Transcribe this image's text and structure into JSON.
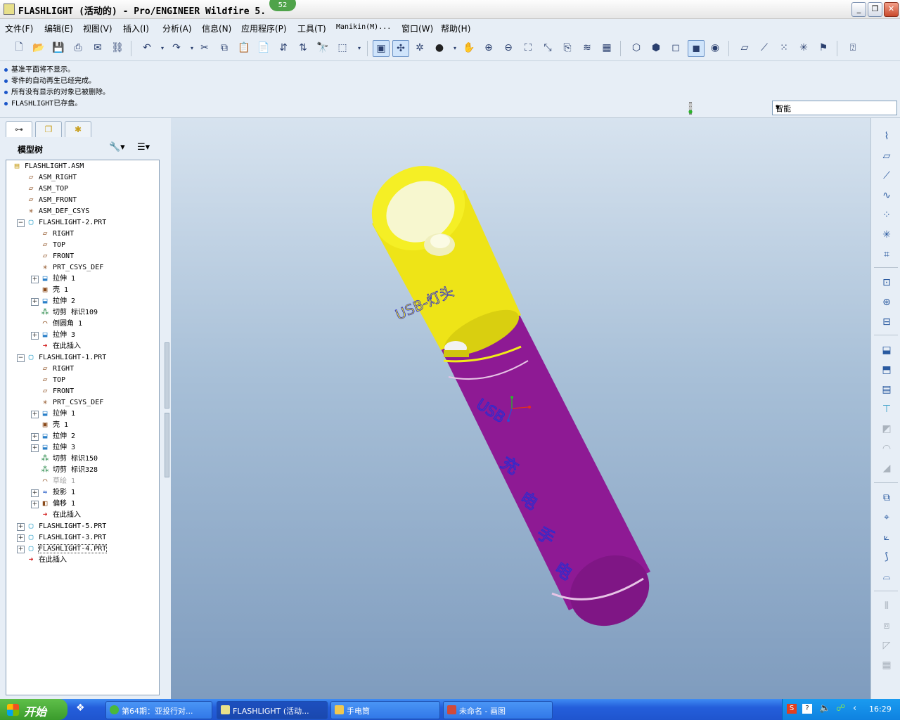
{
  "window": {
    "title": "FLASHLIGHT (活动的) - Pro/ENGINEER Wildfire 5.",
    "badge": "52"
  },
  "menu": [
    "文件(F)",
    "编辑(E)",
    "视图(V)",
    "插入(I)",
    "分析(A)",
    "信息(N)",
    "应用程序(P)",
    "工具(T)",
    "Manikin(M)...",
    "窗口(W)",
    "帮助(H)"
  ],
  "messages": [
    "基准平面将不显示。",
    "零件的自动再生已经完成。",
    "所有没有显示的对象已被删除。",
    "FLASHLIGHT已存盘。"
  ],
  "filter": {
    "selected": "智能"
  },
  "model_tree": {
    "title": "模型树",
    "items": [
      {
        "label": "FLASHLIGHT.ASM",
        "icon": "assembly-icon"
      },
      {
        "label": "ASM_RIGHT",
        "icon": "datum-plane-icon"
      },
      {
        "label": "ASM_TOP",
        "icon": "datum-plane-icon"
      },
      {
        "label": "ASM_FRONT",
        "icon": "datum-plane-icon"
      },
      {
        "label": "ASM_DEF_CSYS",
        "icon": "csys-icon"
      },
      {
        "label": "FLASHLIGHT-2.PRT",
        "icon": "part-icon"
      },
      {
        "label": "RIGHT",
        "icon": "datum-plane-icon"
      },
      {
        "label": "TOP",
        "icon": "datum-plane-icon"
      },
      {
        "label": "FRONT",
        "icon": "datum-plane-icon"
      },
      {
        "label": "PRT_CSYS_DEF",
        "icon": "csys-icon"
      },
      {
        "label": "拉伸 1",
        "icon": "extrude-icon"
      },
      {
        "label": "壳 1",
        "icon": "shell-icon"
      },
      {
        "label": "拉伸 2",
        "icon": "extrude-icon"
      },
      {
        "label": "切剪 标识109",
        "icon": "cut-icon"
      },
      {
        "label": "倒圆角 1",
        "icon": "round-icon"
      },
      {
        "label": "拉伸 3",
        "icon": "extrude-icon"
      },
      {
        "label": "在此插入",
        "icon": "insert-here-icon"
      },
      {
        "label": "FLASHLIGHT-1.PRT",
        "icon": "part-icon"
      },
      {
        "label": "RIGHT",
        "icon": "datum-plane-icon"
      },
      {
        "label": "TOP",
        "icon": "datum-plane-icon"
      },
      {
        "label": "FRONT",
        "icon": "datum-plane-icon"
      },
      {
        "label": "PRT_CSYS_DEF",
        "icon": "csys-icon"
      },
      {
        "label": "拉伸 1",
        "icon": "extrude-icon"
      },
      {
        "label": "壳 1",
        "icon": "shell-icon"
      },
      {
        "label": "拉伸 2",
        "icon": "extrude-icon"
      },
      {
        "label": "拉伸 3",
        "icon": "extrude-icon"
      },
      {
        "label": "切剪 标识150",
        "icon": "cut-icon"
      },
      {
        "label": "切剪 标识328",
        "icon": "cut-icon"
      },
      {
        "label": "草绘 1",
        "icon": "sketch-icon"
      },
      {
        "label": "投影 1",
        "icon": "project-icon"
      },
      {
        "label": "偏移 1",
        "icon": "offset-icon"
      },
      {
        "label": "在此插入",
        "icon": "insert-here-icon"
      },
      {
        "label": "FLASHLIGHT-5.PRT",
        "icon": "part-icon"
      },
      {
        "label": "FLASHLIGHT-3.PRT",
        "icon": "part-icon"
      },
      {
        "label": "FLASHLIGHT-4.PRT",
        "icon": "part-icon"
      },
      {
        "label": "在此插入",
        "icon": "insert-here-icon"
      }
    ]
  },
  "model_text": {
    "head": "USB-灯头",
    "body": [
      "USB",
      "充",
      "电",
      "手",
      "电"
    ]
  },
  "colors": {
    "head": "#f2ec18",
    "body": "#8e1a94",
    "text": "#2b2bd0",
    "background_top": "#d7e3ef",
    "background_bottom": "#7f9cbe"
  },
  "taskbar": {
    "start": "开始",
    "tasks": [
      "第64期：亚投行对...",
      "FLASHLIGHT (活动...",
      "手电筒",
      "未命名 - 画图"
    ],
    "clock": "16:29"
  }
}
